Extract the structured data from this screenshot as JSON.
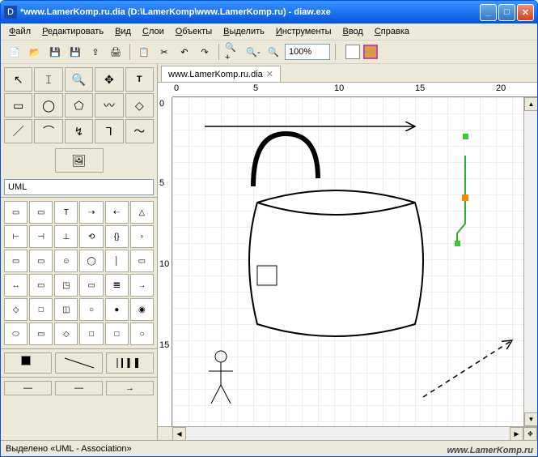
{
  "window": {
    "title": "*www.LamerKomp.ru.dia (D:\\LamerKomp\\www.LamerKomp.ru) - diaw.exe",
    "minimize": "_",
    "maximize": "□",
    "close": "✕"
  },
  "menu": {
    "items": [
      {
        "label": "Файл",
        "key": "Ф"
      },
      {
        "label": "Редактировать",
        "key": "Р"
      },
      {
        "label": "Вид",
        "key": "В"
      },
      {
        "label": "Слои",
        "key": "С"
      },
      {
        "label": "Объекты",
        "key": "О"
      },
      {
        "label": "Выделить",
        "key": "В"
      },
      {
        "label": "Инструменты",
        "key": "И"
      },
      {
        "label": "Ввод",
        "key": "В"
      },
      {
        "label": "Справка",
        "key": "С"
      }
    ]
  },
  "toolbar": {
    "zoom_value": "100%"
  },
  "toolbox": {
    "palette_name": "UML",
    "fill_color": "#000000",
    "bg_color": "#ffffff"
  },
  "tab": {
    "label": "www.LamerKomp.ru.dia"
  },
  "ruler": {
    "top": [
      "0",
      "5",
      "10",
      "15",
      "20"
    ],
    "left": [
      "0",
      "5",
      "10",
      "15"
    ]
  },
  "statusbar": {
    "text": "Выделено «UML - Association»"
  },
  "watermark": "www.LamerKomp.ru"
}
